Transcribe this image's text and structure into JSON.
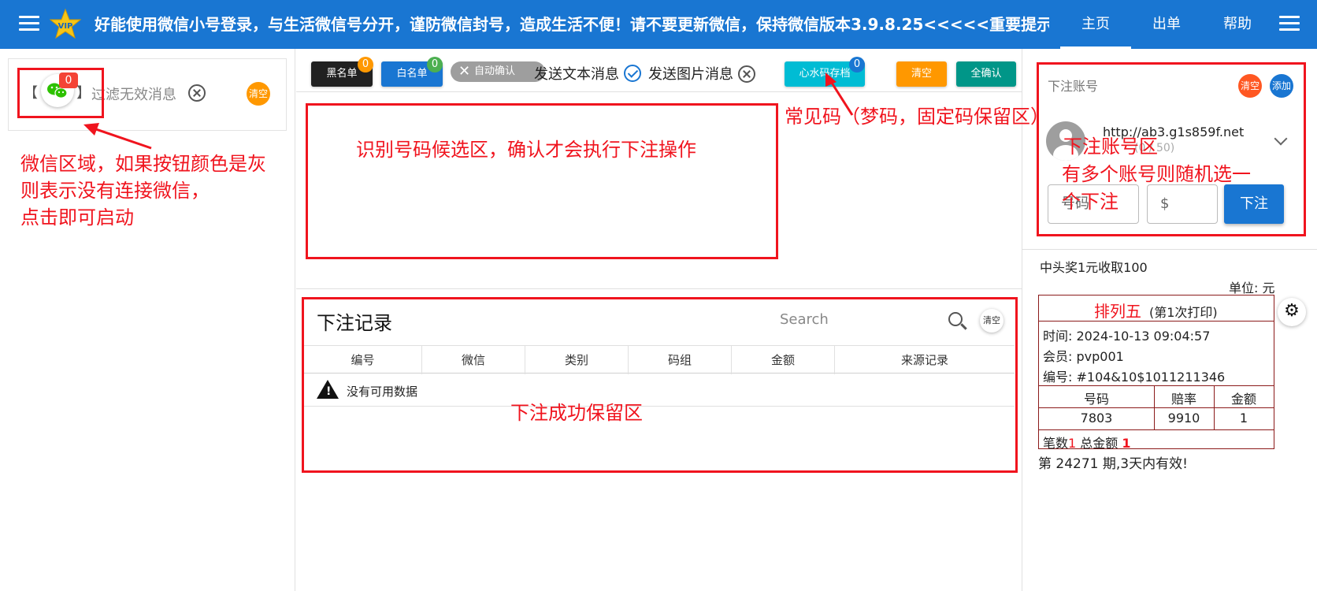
{
  "header": {
    "marquee": "好能使用微信小号登录，与生活微信号分开，谨防微信封号，造成生活不便！请不要更新微信，保持微信版本3.9.8.25<<<<<重要提示>",
    "nav": [
      "主页",
      "出单",
      "帮助"
    ],
    "logo_text": "VIP"
  },
  "wechat": {
    "bracket_open": "【",
    "bracket_close": "】",
    "count": "0",
    "filter_text": "过滤无效消息",
    "clear_label": "清空"
  },
  "toolbar": {
    "blacklist_label": "黑名单",
    "blacklist_count": "0",
    "whitelist_label": "白名单",
    "whitelist_count": "0",
    "auto_confirm_label": "自动确认",
    "chip_close": "✕",
    "send_text_label": "发送文本消息",
    "send_image_label": "发送图片消息",
    "common_codes_label": "心水码存档",
    "common_codes_count": "0",
    "clear_label": "清空",
    "confirm_all_label": "全确认"
  },
  "records": {
    "title": "下注记录",
    "search_placeholder": "Search",
    "clear_label": "清空",
    "columns": [
      "编号",
      "微信",
      "类别",
      "码组",
      "金额",
      "来源记录"
    ],
    "empty_text": "没有可用数据",
    "warning_glyph": "!"
  },
  "account": {
    "label": "下注账号",
    "clear_label": "清空",
    "add_label": "添加",
    "url": "http://ab3.g1s859f.net",
    "sub_text": "(0 / 50)",
    "number_placeholder": "号码",
    "amount_placeholder": "$",
    "bet_label": "下注"
  },
  "info": {
    "line1": "中头奖1元收取100",
    "unit": "单位: 元",
    "gear_glyph": "⚙"
  },
  "receipt": {
    "title": "排列五",
    "title_suffix": "(第1次打印)",
    "time": "时间: 2024-10-13 09:04:57",
    "member": "会员: pvp001",
    "number": "编号: #104&10$1011211346",
    "headers": [
      "号码",
      "赔率",
      "金额"
    ],
    "row": [
      "7803",
      "9910",
      "1"
    ],
    "count_label": "笔数",
    "count_value": "1",
    "total_label": " 总金额 ",
    "total_value": "1",
    "footer": "第 24271 期,3天内有效!"
  },
  "annotations": {
    "wechat_area": [
      "微信区域，如果按钮颜色是灰",
      "则表示没有连接微信，",
      "点击即可启动"
    ],
    "candidate_area": "识别号码候选区，确认才会执行下注操作",
    "common_codes": "常见码（梦码，固定码保留区）",
    "success_area": "下注成功保留区",
    "account_area": [
      "下注账号区",
      "有多个账号则随机选一",
      "个下注"
    ]
  },
  "colors": {
    "primary": "#1976d2",
    "annotation_red": "#f0141e",
    "orange": "#ff9800",
    "green_badge": "#4caf50",
    "teal": "#009688",
    "cyan": "#00bcd4",
    "receipt_border": "#8b1a1a"
  }
}
